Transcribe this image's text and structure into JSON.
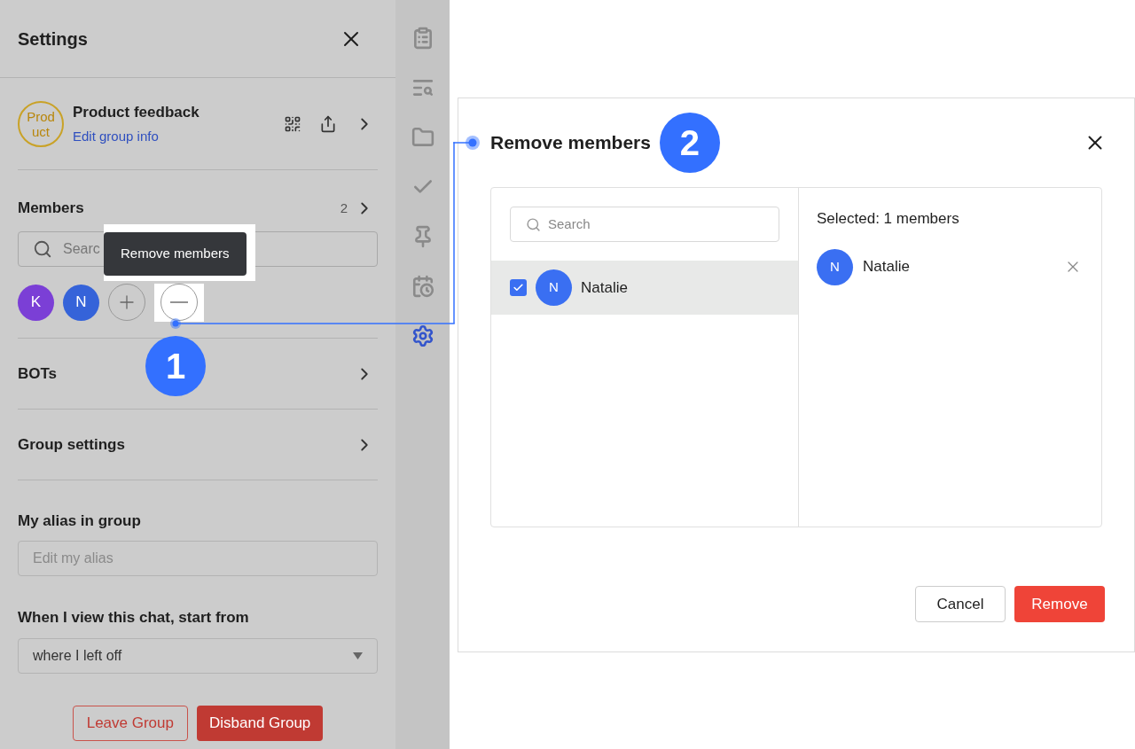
{
  "settings": {
    "title": "Settings",
    "group": {
      "avatar_text": "Product",
      "name": "Product feedback",
      "edit_link": "Edit group info"
    },
    "members": {
      "label": "Members",
      "count": "2",
      "search_placeholder": "Searc",
      "avatars": [
        {
          "letter": "K",
          "color": "#7b3fd6"
        },
        {
          "letter": "N",
          "color": "#3563d9"
        }
      ],
      "tooltip": "Remove members"
    },
    "sections": [
      {
        "label": "BOTs"
      },
      {
        "label": "Group settings"
      }
    ],
    "alias": {
      "label": "My alias in group",
      "placeholder": "Edit my alias"
    },
    "start_from": {
      "label": "When I view this chat, start from",
      "value": "where I left off"
    },
    "buttons": [
      {
        "label": "Leave Group",
        "kind": "outline"
      },
      {
        "label": "Disband Group",
        "kind": "danger"
      }
    ]
  },
  "rail": [
    {
      "kind": "clipboard",
      "selected": false
    },
    {
      "kind": "list-search",
      "selected": false
    },
    {
      "kind": "folder",
      "selected": false
    },
    {
      "kind": "check",
      "selected": false
    },
    {
      "kind": "pin",
      "selected": false
    },
    {
      "kind": "calendar",
      "selected": false
    },
    {
      "kind": "settings",
      "selected": true
    }
  ],
  "steps": [
    "1",
    "2"
  ],
  "dialog": {
    "title": "Remove members",
    "search_placeholder": "Search",
    "members": [
      {
        "letter": "N",
        "name": "Natalie",
        "checked": true,
        "selected": true
      }
    ],
    "selected_label": "Selected: 1 members",
    "selected": [
      {
        "letter": "N",
        "name": "Natalie"
      }
    ],
    "buttons": [
      {
        "label": "Cancel",
        "kind": "secondary"
      },
      {
        "label": "Remove",
        "kind": "danger"
      }
    ]
  }
}
